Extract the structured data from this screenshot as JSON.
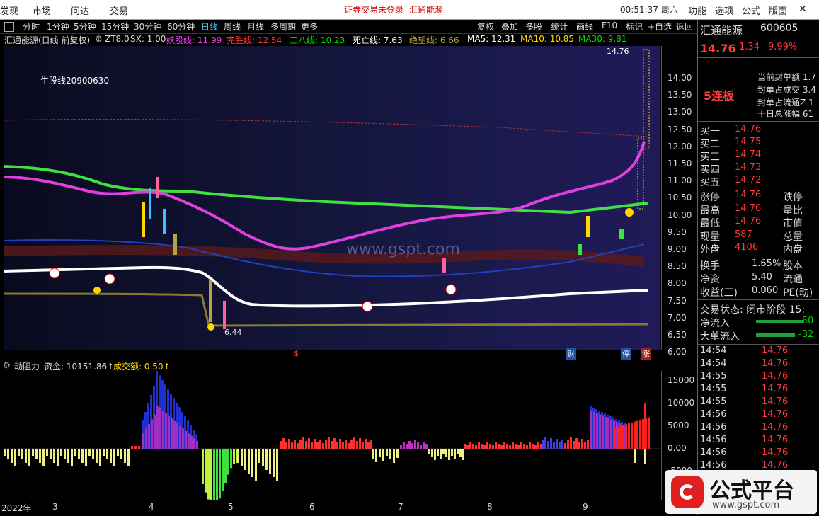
{
  "menu": {
    "items": [
      "发现",
      "市场",
      "问达",
      "交易"
    ],
    "center_notice": "证券交易未登录",
    "center_stock": "汇通能源",
    "clock": "00:51:37 周六",
    "right_items": [
      "功能",
      "选项",
      "公式",
      "版面"
    ],
    "close_glyph": "✕"
  },
  "toolbar": {
    "periods": [
      "分时",
      "1分钟",
      "5分钟",
      "15分钟",
      "30分钟",
      "60分钟",
      "日线",
      "周线",
      "月线",
      "多周期",
      "更多"
    ],
    "active_period": "日线",
    "tools": [
      "复权",
      "叠加",
      "多股",
      "统计",
      "画线",
      "F10",
      "标记",
      "+自选",
      "返回"
    ]
  },
  "indicator_bar": {
    "title": "汇通能源(日线 前复权)",
    "items": [
      {
        "label": "ZT8.0",
        "color": "#dddddd"
      },
      {
        "label": "SX: 1.00",
        "color": "#dddddd"
      },
      {
        "label": "妖股线: 11.99",
        "color": "#ff3cff"
      },
      {
        "label": "完胜线: 12.54",
        "color": "#ff3b3b"
      },
      {
        "label": "三八线: 10.23",
        "color": "#00e000"
      },
      {
        "label": "死亡线: 7.63",
        "color": "#ffffff"
      },
      {
        "label": "绝望线: 6.66",
        "color": "#b5a642"
      },
      {
        "label": "MA5: 12.31",
        "color": "#ffffff"
      },
      {
        "label": "MA10: 10.85",
        "color": "#ffd800"
      },
      {
        "label": "MA30: 9.81",
        "color": "#00e000"
      }
    ]
  },
  "main_chart": {
    "annotation_top": "牛股线20900630",
    "high_label": "14.76",
    "low_label": "6.44",
    "watermark": "www.gspt.com",
    "y_ticks": [
      "14.00",
      "13.50",
      "13.00",
      "12.50",
      "12.00",
      "11.50",
      "11.00",
      "10.50",
      "10.00",
      "9.50",
      "9.00",
      "8.50",
      "8.00",
      "7.50",
      "7.00",
      "6.50",
      "6.00"
    ],
    "bottom_marks": [
      "$",
      "财",
      "停",
      "涨"
    ]
  },
  "sub_chart": {
    "title": "动阻力",
    "fund_label": "资金: 10151.86↑",
    "volume_label": "成交额: 0.50↑",
    "y_ticks": [
      "15000",
      "10000",
      "5000",
      "0.00",
      "-5000"
    ]
  },
  "x_axis": {
    "labels": [
      "2022年",
      "3",
      "4",
      "5",
      "6",
      "7",
      "8",
      "9"
    ]
  },
  "quote_panel": {
    "name": "汇通能源",
    "code": "600605",
    "price": "14.76",
    "change": "1.34",
    "change_pct": "9.99%",
    "limit_text": "5连板",
    "seal_rows": [
      "当前封单额 1.7",
      "封单占成交 3.4",
      "封单占流通Z 1",
      "十日总涨幅 61"
    ],
    "bids": [
      {
        "label": "买一",
        "price": "14.76"
      },
      {
        "label": "买二",
        "price": "14.75"
      },
      {
        "label": "买三",
        "price": "14.74"
      },
      {
        "label": "买四",
        "price": "14.73"
      },
      {
        "label": "买五",
        "price": "14.72"
      }
    ],
    "stats": [
      {
        "label": "涨停",
        "value": "14.76",
        "right": "跌停"
      },
      {
        "label": "最高",
        "value": "14.76",
        "right": "量比"
      },
      {
        "label": "最低",
        "value": "14.76",
        "right": "市值"
      },
      {
        "label": "现量",
        "value": "587",
        "right": "总量"
      },
      {
        "label": "外盘",
        "value": "4106",
        "right": "内盘"
      }
    ],
    "fundamentals": [
      {
        "label": "换手",
        "value": "1.65%",
        "right": "股本"
      },
      {
        "label": "净资",
        "value": "5.40",
        "right": "流通"
      },
      {
        "label": "收益(三)",
        "value": "0.060",
        "right": "PE(动)"
      }
    ],
    "trade_state": "交易状态: 闭市阶段 15:",
    "net_inflow_label": "净流入",
    "net_inflow_value": "-50",
    "big_inflow_label": "大单流入",
    "big_inflow_value": "-32",
    "ticks": [
      {
        "time": "14:54",
        "price": "14.76"
      },
      {
        "time": "14:54",
        "price": "14.76"
      },
      {
        "time": "14:55",
        "price": "14.76"
      },
      {
        "time": "14:55",
        "price": "14.76"
      },
      {
        "time": "14:55",
        "price": "14.76"
      },
      {
        "time": "14:56",
        "price": "14.76"
      },
      {
        "time": "14:56",
        "price": "14.76"
      },
      {
        "time": "14:56",
        "price": "14.76"
      },
      {
        "time": "14:56",
        "price": "14.76"
      },
      {
        "time": "14:56",
        "price": "14.76"
      }
    ]
  },
  "brand": {
    "name": "公式平台",
    "url": "www.gspt.com"
  }
}
